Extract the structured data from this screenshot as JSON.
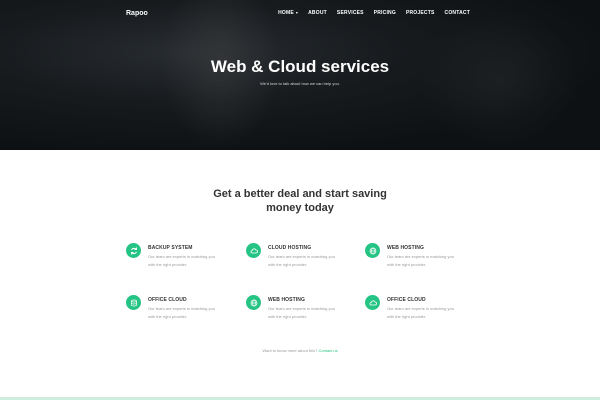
{
  "brand": "Rapoo",
  "nav": {
    "items": [
      {
        "label": "HOME",
        "has_dropdown": true
      },
      {
        "label": "ABOUT"
      },
      {
        "label": "SERVICES"
      },
      {
        "label": "PRICING"
      },
      {
        "label": "PROJECTS"
      },
      {
        "label": "CONTACT"
      }
    ]
  },
  "hero": {
    "title": "Web & Cloud services",
    "subtitle": "We'd love to talk about how we can help you."
  },
  "section": {
    "title_line1": "Get a better deal and start saving",
    "title_line2": "money today"
  },
  "services": [
    {
      "name": "BACKUP SYSTEM",
      "desc_line1": "Our team are experts in matching you",
      "desc_line2": "with the right provider.",
      "icon": "refresh-icon"
    },
    {
      "name": "CLOUD HOSTING",
      "desc_line1": "Our team are experts in matching you",
      "desc_line2": "with the right provider.",
      "icon": "cloud-icon"
    },
    {
      "name": "WEB HOSTING",
      "desc_line1": "Our team are experts in matching you",
      "desc_line2": "with the right provider.",
      "icon": "globe-icon"
    },
    {
      "name": "OFFICE CLOUD",
      "desc_line1": "Our team are experts in matching you",
      "desc_line2": "with the right provider.",
      "icon": "database-icon"
    },
    {
      "name": "WEB HOSTING",
      "desc_line1": "Our team are experts in matching you",
      "desc_line2": "with the right provider.",
      "icon": "globe-icon"
    },
    {
      "name": "OFFICE CLOUD",
      "desc_line1": "Our team are experts in matching you",
      "desc_line2": "with the right provider.",
      "icon": "cloud-icon"
    }
  ],
  "footer_note": {
    "text": "Want to know more about this?",
    "link": "Contact us"
  },
  "colors": {
    "accent": "#26c484",
    "hero_bg": "#1b1f22"
  }
}
